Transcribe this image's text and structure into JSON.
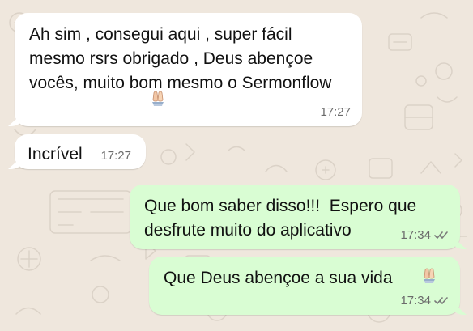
{
  "chat": {
    "messages": [
      {
        "direction": "incoming",
        "text": "Ah sim , consegui aqui , super fácil mesmo rsrs obrigado , Deus abençoe vocês, muito bom mesmo o Sermonflow",
        "time": "17:27",
        "emoji": "praying-hands"
      },
      {
        "direction": "incoming",
        "text": "Incrível",
        "time": "17:27"
      },
      {
        "direction": "outgoing",
        "text": "Que bom saber disso!!!  Espero que desfrute muito do aplicativo",
        "time": "17:34",
        "status": "double-check"
      },
      {
        "direction": "outgoing",
        "text": "Que Deus abençoe a sua vida",
        "time": "17:34",
        "status": "double-check",
        "emoji": "praying-hands"
      }
    ]
  },
  "theme": {
    "background": "#efe7dd",
    "incoming_bubble": "#ffffff",
    "outgoing_bubble": "#d9fdd3",
    "timestamp": "#6b6b6b"
  },
  "icons": {
    "emoji": "praying-hands-icon",
    "status": "double-check-icon"
  }
}
